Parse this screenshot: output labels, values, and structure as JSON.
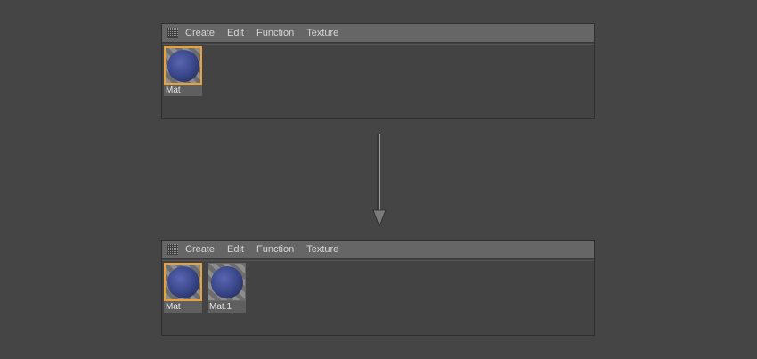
{
  "menu": {
    "items": [
      "Create",
      "Edit",
      "Function",
      "Texture"
    ]
  },
  "top_panel": {
    "materials": [
      {
        "label": "Mat",
        "selected": true
      }
    ]
  },
  "bottom_panel": {
    "materials": [
      {
        "label": "Mat",
        "selected": true
      },
      {
        "label": "Mat.1",
        "selected": false
      }
    ]
  },
  "colors": {
    "background": "#454545",
    "menubar": "#666666",
    "selection": "#e8a23d",
    "sphere": "#3d4a8f"
  },
  "icons": [
    "grip-icon",
    "material-sphere-icon",
    "down-arrow-icon"
  ]
}
